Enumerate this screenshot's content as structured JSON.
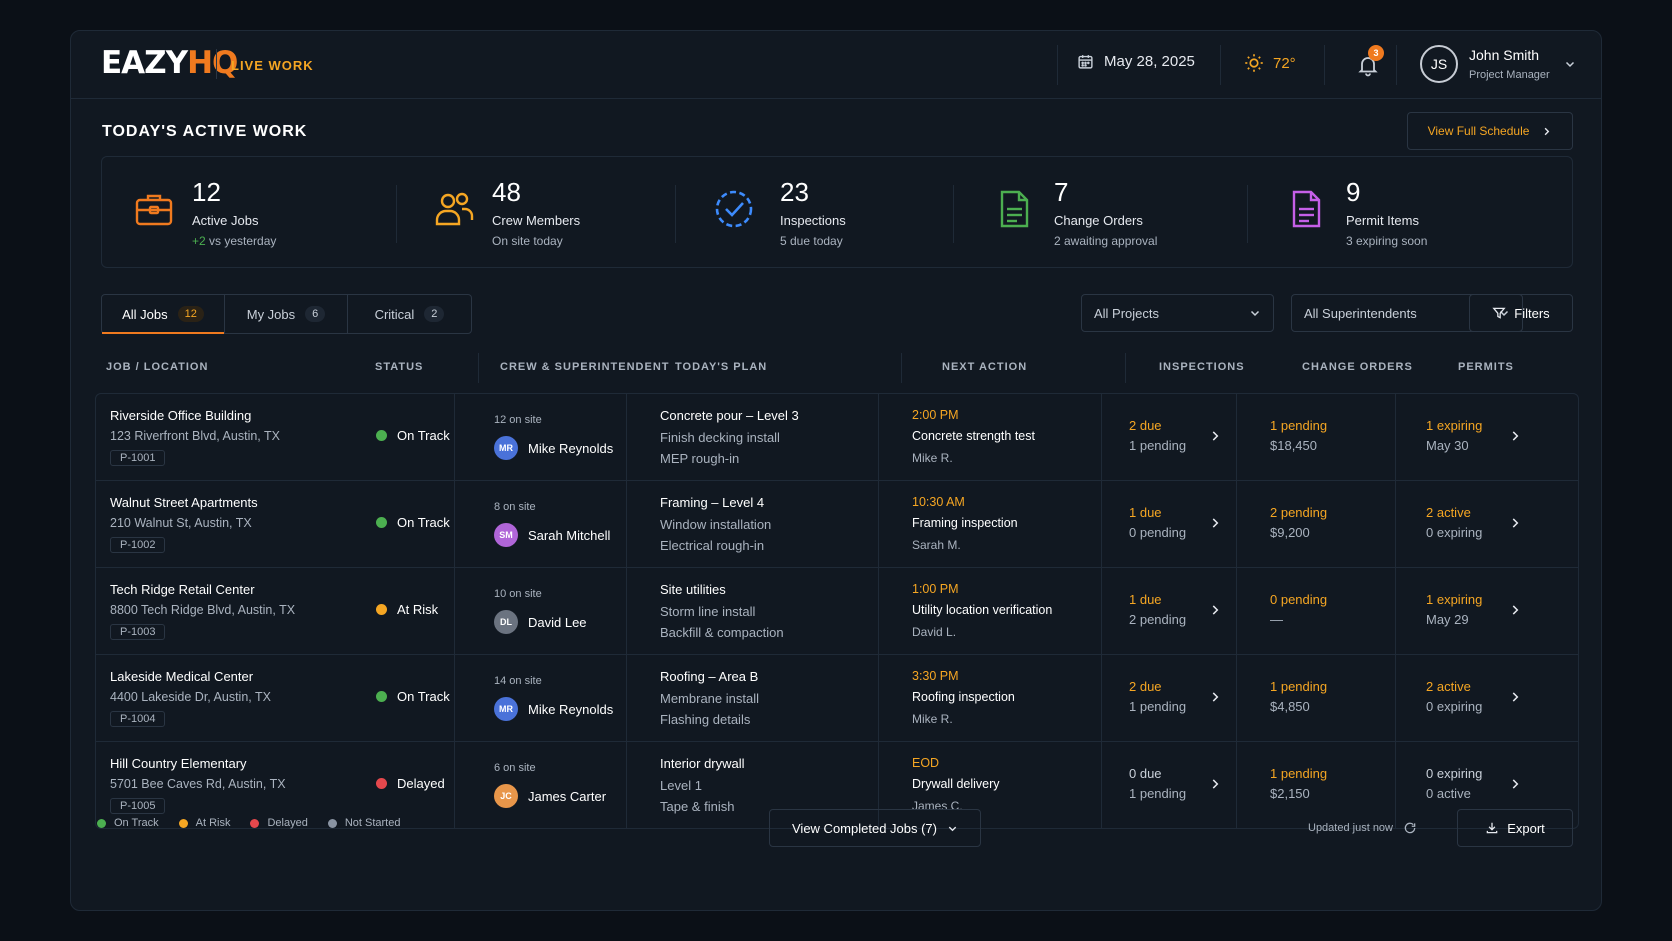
{
  "app": {
    "logo_a": "EAZY",
    "logo_b": "HQ",
    "section": "LIVE WORK"
  },
  "topbar": {
    "date": "May 28, 2025",
    "temperature": "72°",
    "notifications": "3",
    "user_initials": "JS",
    "user_name": "John Smith",
    "user_role": "Project Manager"
  },
  "page": {
    "title": "TODAY'S ACTIVE WORK",
    "full_schedule": "View Full Schedule"
  },
  "stats": [
    {
      "icon": "briefcase-icon",
      "color": "#f07a1f",
      "value": "12",
      "label": "Active Jobs",
      "sub_pos": "+2",
      "sub": " vs yesterday"
    },
    {
      "icon": "crew-icon",
      "color": "#f5a623",
      "value": "48",
      "label": "Crew Members",
      "sub_pos": "",
      "sub": "On site today"
    },
    {
      "icon": "inspection-check-icon",
      "color": "#3d8bfd",
      "value": "23",
      "label": "Inspections",
      "sub_pos": "",
      "sub": "5 due today"
    },
    {
      "icon": "document-icon",
      "color": "#4caf50",
      "value": "7",
      "label": "Change Orders",
      "sub_pos": "",
      "sub": "2 awaiting approval"
    },
    {
      "icon": "permit-icon",
      "color": "#c55fe8",
      "value": "9",
      "label": "Permit Items",
      "sub_pos": "",
      "sub": "3 expiring soon"
    }
  ],
  "tabs": [
    {
      "label": "All Jobs",
      "count": "12"
    },
    {
      "label": "My Jobs",
      "count": "6"
    },
    {
      "label": "Critical",
      "count": "2"
    }
  ],
  "filters": {
    "projects": "All Projects",
    "superintendents": "All Superintendents",
    "filters": "Filters"
  },
  "columns": [
    "JOB / LOCATION",
    "STATUS",
    "CREW & SUPERINTENDENT",
    "TODAY'S PLAN",
    "NEXT ACTION",
    "INSPECTIONS",
    "CHANGE ORDERS",
    "PERMITS"
  ],
  "rows": [
    {
      "name": "Riverside Office Building",
      "address": "123 Riverfront Blvd, Austin, TX",
      "id": "P-1001",
      "status": "On Track",
      "status_color": "#4caf50",
      "crew_count": "12 on site",
      "initials": "MR",
      "avatar_color": "#4a72d9",
      "super": "Mike Reynolds",
      "plan": [
        "Concrete pour – Level 3",
        "Finish decking install",
        "MEP rough-in"
      ],
      "next_time": "2:00 PM",
      "next_action": "Concrete strength test",
      "next_who": "Mike R.",
      "insp_top": "2 due",
      "insp_bot": "1 pending",
      "insp_hl": true,
      "co_top": "1 pending",
      "co_bot": "$18,450",
      "co_hl": true,
      "permit_top": "1 expiring",
      "permit_bot": "May 30",
      "permit_hl": true
    },
    {
      "name": "Walnut Street Apartments",
      "address": "210 Walnut St, Austin, TX",
      "id": "P-1002",
      "status": "On Track",
      "status_color": "#4caf50",
      "crew_count": "8 on site",
      "initials": "SM",
      "avatar_color": "#b065d8",
      "super": "Sarah Mitchell",
      "plan": [
        "Framing – Level 4",
        "Window installation",
        "Electrical rough-in"
      ],
      "next_time": "10:30 AM",
      "next_action": "Framing inspection",
      "next_who": "Sarah M.",
      "insp_top": "1 due",
      "insp_bot": "0 pending",
      "insp_hl": true,
      "co_top": "2 pending",
      "co_bot": "$9,200",
      "co_hl": true,
      "permit_top": "2 active",
      "permit_bot": "0 expiring",
      "permit_hl": true
    },
    {
      "name": "Tech Ridge Retail Center",
      "address": "8800 Tech Ridge Blvd, Austin, TX",
      "id": "P-1003",
      "status": "At Risk",
      "status_color": "#f5a623",
      "crew_count": "10 on site",
      "initials": "DL",
      "avatar_color": "#6b7380",
      "super": "David Lee",
      "plan": [
        "Site utilities",
        "Storm line install",
        "Backfill & compaction"
      ],
      "next_time": "1:00 PM",
      "next_action": "Utility location verification",
      "next_who": "David L.",
      "insp_top": "1 due",
      "insp_bot": "2 pending",
      "insp_hl": true,
      "co_top": "0 pending",
      "co_bot": "—",
      "co_hl": true,
      "permit_top": "1 expiring",
      "permit_bot": "May 29",
      "permit_hl": true
    },
    {
      "name": "Lakeside Medical Center",
      "address": "4400 Lakeside Dr, Austin, TX",
      "id": "P-1004",
      "status": "On Track",
      "status_color": "#4caf50",
      "crew_count": "14 on site",
      "initials": "MR",
      "avatar_color": "#4a72d9",
      "super": "Mike Reynolds",
      "plan": [
        "Roofing – Area B",
        "Membrane install",
        "Flashing details"
      ],
      "next_time": "3:30 PM",
      "next_action": "Roofing inspection",
      "next_who": "Mike R.",
      "insp_top": "2 due",
      "insp_bot": "1 pending",
      "insp_hl": true,
      "co_top": "1 pending",
      "co_bot": "$4,850",
      "co_hl": true,
      "permit_top": "2 active",
      "permit_bot": "0 expiring",
      "permit_hl": true
    },
    {
      "name": "Hill Country Elementary",
      "address": "5701 Bee Caves Rd, Austin, TX",
      "id": "P-1005",
      "status": "Delayed",
      "status_color": "#e5484d",
      "crew_count": "6 on site",
      "initials": "JC",
      "avatar_color": "#e8964a",
      "super": "James Carter",
      "plan": [
        "Interior drywall",
        "Level 1",
        "Tape & finish"
      ],
      "next_time": "EOD",
      "next_action": "Drywall delivery",
      "next_who": "James C.",
      "insp_top": "0 due",
      "insp_bot": "1 pending",
      "insp_hl": false,
      "co_top": "1 pending",
      "co_bot": "$2,150",
      "co_hl": true,
      "permit_top": "0 expiring",
      "permit_bot": "0 active",
      "permit_hl": false
    }
  ],
  "legend": [
    {
      "label": "On Track",
      "color": "#4caf50"
    },
    {
      "label": "At Risk",
      "color": "#f5a623"
    },
    {
      "label": "Delayed",
      "color": "#e5484d"
    },
    {
      "label": "Not Started",
      "color": "#8a94a3"
    }
  ],
  "footer": {
    "view_completed": "View Completed Jobs (7)",
    "updated": "Updated just now",
    "export": "Export"
  }
}
